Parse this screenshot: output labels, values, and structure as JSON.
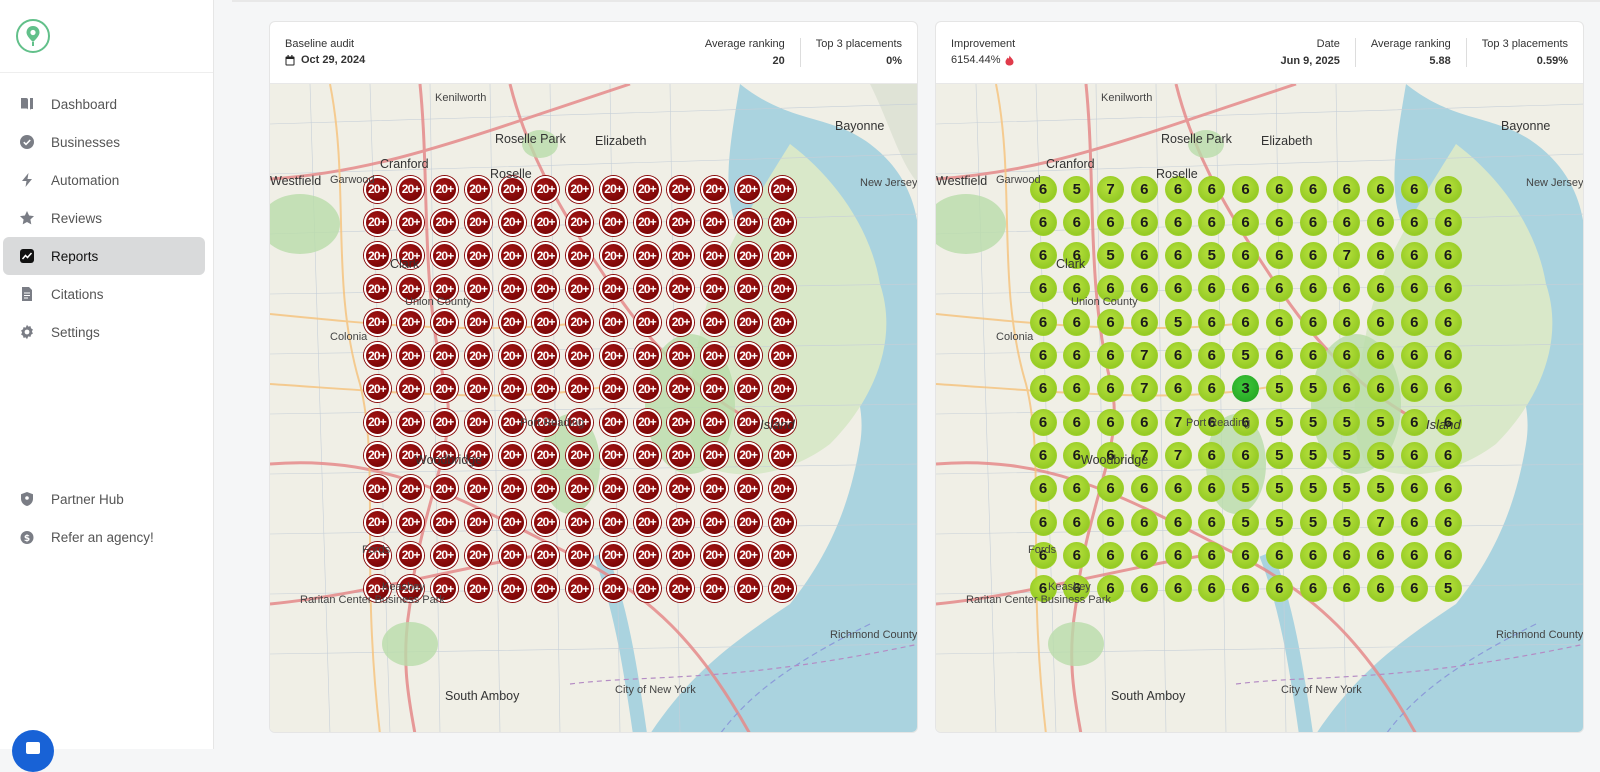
{
  "sidebar": {
    "nav": [
      {
        "label": "Dashboard",
        "icon": "book-icon",
        "active": false
      },
      {
        "label": "Businesses",
        "icon": "check-badge-icon",
        "active": false
      },
      {
        "label": "Automation",
        "icon": "bolt-icon",
        "active": false
      },
      {
        "label": "Reviews",
        "icon": "star-icon",
        "active": false
      },
      {
        "label": "Reports",
        "icon": "chart-icon",
        "active": true
      },
      {
        "label": "Citations",
        "icon": "document-icon",
        "active": false
      },
      {
        "label": "Settings",
        "icon": "gear-icon",
        "active": false
      }
    ],
    "bottom": [
      {
        "label": "Partner Hub",
        "icon": "shield-icon"
      },
      {
        "label": "Refer an agency!",
        "icon": "money-icon"
      }
    ]
  },
  "baseline": {
    "label": "Baseline audit",
    "date": "Oct 29, 2024",
    "avg_ranking_label": "Average ranking",
    "avg_ranking": "20",
    "top3_label": "Top 3 placements",
    "top3": "0%",
    "grid_label": "20+",
    "grid": [
      [
        20,
        20,
        20,
        20,
        20,
        20,
        20,
        20,
        20,
        20,
        20,
        20,
        20
      ],
      [
        20,
        20,
        20,
        20,
        20,
        20,
        20,
        20,
        20,
        20,
        20,
        20,
        20
      ],
      [
        20,
        20,
        20,
        20,
        20,
        20,
        20,
        20,
        20,
        20,
        20,
        20,
        20
      ],
      [
        20,
        20,
        20,
        20,
        20,
        20,
        20,
        20,
        20,
        20,
        20,
        20,
        20
      ],
      [
        20,
        20,
        20,
        20,
        20,
        20,
        20,
        20,
        20,
        20,
        20,
        20,
        20
      ],
      [
        20,
        20,
        20,
        20,
        20,
        20,
        20,
        20,
        20,
        20,
        20,
        20,
        20
      ],
      [
        20,
        20,
        20,
        20,
        20,
        20,
        20,
        20,
        20,
        20,
        20,
        20,
        20
      ],
      [
        20,
        20,
        20,
        20,
        20,
        20,
        20,
        20,
        20,
        20,
        20,
        20,
        20
      ],
      [
        20,
        20,
        20,
        20,
        20,
        20,
        20,
        20,
        20,
        20,
        20,
        20,
        20
      ],
      [
        20,
        20,
        20,
        20,
        20,
        20,
        20,
        20,
        20,
        20,
        20,
        20,
        20
      ],
      [
        20,
        20,
        20,
        20,
        20,
        20,
        20,
        20,
        20,
        20,
        20,
        20,
        20
      ],
      [
        20,
        20,
        20,
        20,
        20,
        20,
        20,
        20,
        20,
        20,
        20,
        20,
        20
      ],
      [
        20,
        20,
        20,
        20,
        20,
        20,
        20,
        20,
        20,
        20,
        20,
        20,
        20
      ]
    ]
  },
  "current": {
    "improvement_label": "Improvement",
    "improvement": "6154.44%",
    "date_label": "Date",
    "date": "Jun 9, 2025",
    "avg_ranking_label": "Average ranking",
    "avg_ranking": "5.88",
    "top3_label": "Top 3 placements",
    "top3": "0.59%",
    "grid": [
      [
        6,
        5,
        7,
        6,
        6,
        6,
        6,
        6,
        6,
        6,
        6,
        6,
        6
      ],
      [
        6,
        6,
        6,
        6,
        6,
        6,
        6,
        6,
        6,
        6,
        6,
        6,
        6
      ],
      [
        6,
        6,
        5,
        6,
        6,
        5,
        6,
        6,
        6,
        7,
        6,
        6,
        6
      ],
      [
        6,
        6,
        6,
        6,
        6,
        6,
        6,
        6,
        6,
        6,
        6,
        6,
        6
      ],
      [
        6,
        6,
        6,
        6,
        5,
        6,
        6,
        6,
        6,
        6,
        6,
        6,
        6
      ],
      [
        6,
        6,
        6,
        7,
        6,
        6,
        5,
        6,
        6,
        6,
        6,
        6,
        6
      ],
      [
        6,
        6,
        6,
        7,
        6,
        6,
        3,
        5,
        5,
        6,
        6,
        6,
        6
      ],
      [
        6,
        6,
        6,
        6,
        7,
        6,
        6,
        5,
        5,
        5,
        5,
        6,
        6
      ],
      [
        6,
        6,
        6,
        7,
        7,
        6,
        6,
        5,
        5,
        5,
        5,
        6,
        6
      ],
      [
        6,
        6,
        6,
        6,
        6,
        6,
        5,
        5,
        5,
        5,
        5,
        6,
        6
      ],
      [
        6,
        6,
        6,
        6,
        6,
        6,
        5,
        5,
        5,
        5,
        7,
        6,
        6
      ],
      [
        6,
        6,
        6,
        6,
        6,
        6,
        6,
        6,
        6,
        6,
        6,
        6,
        6
      ],
      [
        6,
        6,
        6,
        6,
        6,
        6,
        6,
        6,
        6,
        6,
        6,
        6,
        5
      ]
    ]
  },
  "map_labels": [
    {
      "text": "Bayonne",
      "cls": "big"
    },
    {
      "text": "Elizabeth",
      "cls": "big"
    },
    {
      "text": "Roselle Park",
      "cls": "big"
    },
    {
      "text": "Cranford",
      "cls": "big"
    },
    {
      "text": "Roselle",
      "cls": "big"
    },
    {
      "text": "Westfield",
      "cls": "big"
    },
    {
      "text": "Garwood",
      "cls": ""
    },
    {
      "text": "Kenilworth",
      "cls": ""
    },
    {
      "text": "Clark",
      "cls": "big"
    },
    {
      "text": "Colonia",
      "cls": ""
    },
    {
      "text": "Woodbridge",
      "cls": "big"
    },
    {
      "text": "Port Reading",
      "cls": ""
    },
    {
      "text": "Fords",
      "cls": ""
    },
    {
      "text": "Keasbey",
      "cls": ""
    },
    {
      "text": "South Amboy",
      "cls": "big"
    },
    {
      "text": "Island",
      "cls": "island"
    },
    {
      "text": "City of New York",
      "cls": ""
    },
    {
      "text": "New Jersey",
      "cls": ""
    },
    {
      "text": "Union County",
      "cls": ""
    },
    {
      "text": "Richmond County",
      "cls": ""
    },
    {
      "text": "Raritan Center Business Park",
      "cls": ""
    }
  ],
  "colors": {
    "accent": "#62c08a",
    "bad": "#8a0b0b",
    "good": "#9fd02a",
    "best": "#2bb52b",
    "water": "#aad3df"
  }
}
